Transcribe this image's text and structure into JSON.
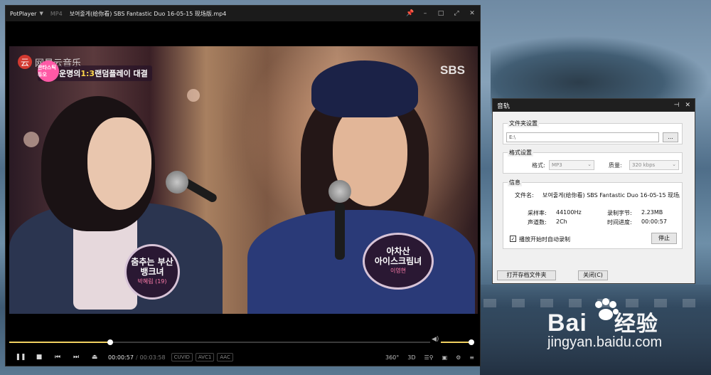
{
  "player": {
    "app_name": "PotPlayer",
    "format": "MP4",
    "file_title": "보여줄게(给你看) SBS Fantastic Duo 16-05-15 现场版.mp4",
    "window_buttons": [
      "📌",
      "–",
      "□",
      "⤢",
      "✕"
    ],
    "video": {
      "watermark_text": "网易云音乐",
      "watermark_logo": "云",
      "show_logo_text": "판타스틱 듀오",
      "banner_before": "운명의 ",
      "banner_highlight": "1:3",
      "banner_after": " 랜덤플레이 대결",
      "broadcaster": "SBS",
      "badge_left_line1": "춤추는 부산",
      "badge_left_line2": "뱅크녀",
      "badge_left_sub": "박혜림 (19)",
      "badge_right_line1": "아차산",
      "badge_right_line2": "아이스크림녀",
      "badge_right_sub": "이영현"
    },
    "seek_progress": 0.24,
    "volume_level": 1.0,
    "controls": {
      "play_pause": "❚❚",
      "stop": "■",
      "prev": "⏮",
      "next": "⏭",
      "eject": "⏏",
      "time_current": "00:00:57",
      "time_separator": "/",
      "time_total": "00:03:58",
      "tags": [
        "CUVID",
        "AVC1",
        "AAC"
      ],
      "right": [
        "360°",
        "3D",
        "☰⚲",
        "▣",
        "⚙",
        "≡"
      ]
    }
  },
  "dialog": {
    "title": "音轨",
    "title_buttons": [
      "⊣",
      "✕"
    ],
    "folder_group_title": "文件夹设置",
    "folder_path": "E:\\",
    "browse_label": "...",
    "format_group_title": "格式设置",
    "format_label": "格式:",
    "format_value": "MP3",
    "quality_label": "质量:",
    "quality_value": "320 kbps",
    "info_group_title": "信息",
    "filename_label": "文件名:",
    "filename_value": "보여줄게(给你看) SBS Fantastic Duo 16-05-15 现场版",
    "samplerate_label": "采样率:",
    "samplerate_value": "44100Hz",
    "recorded_label": "录制字节:",
    "recorded_value": "2.23MB",
    "channels_label": "声道数:",
    "channels_value": "2Ch",
    "progress_label": "时间进度:",
    "progress_value": "00:00:57",
    "autorecord_label": "播放开始时自动录制",
    "autorecord_checked": "✓",
    "stop_button": "停止",
    "open_folder_button": "打开存档文件夹",
    "close_button": "关闭(C)"
  },
  "watermark": {
    "brand_left": "Bai",
    "brand_right": "经验",
    "url": "jingyan.baidu.com"
  },
  "colors": {
    "accent": "#f0d060",
    "titlebar": "#1b1b1b",
    "dialog_bg": "#f0f0f0"
  }
}
